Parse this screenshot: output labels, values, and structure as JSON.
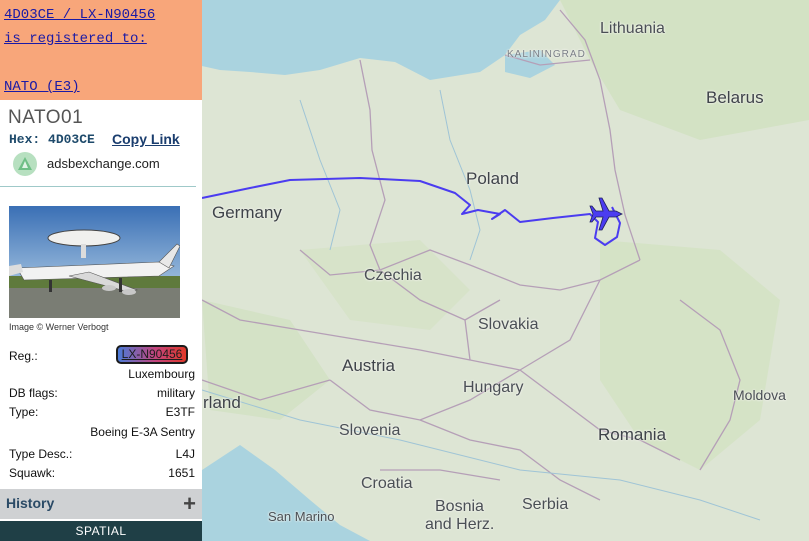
{
  "map": {
    "countries": [
      "Lithuania",
      "Belarus",
      "Poland",
      "Germany",
      "Czechia",
      "Slovakia",
      "Austria",
      "Hungary",
      "Slovenia",
      "Croatia",
      "Romania",
      "Moldova",
      "Bosnia and Herz.",
      "Serbia",
      "San Marino"
    ],
    "label_lithuania": "Lithuania",
    "label_belarus": "Belarus",
    "label_poland": "Poland",
    "label_germany": "Germany",
    "label_czechia": "Czechia",
    "label_slovakia": "Slovakia",
    "label_austria": "Austria",
    "label_hungary": "Hungary",
    "label_slovenia": "Slovenia",
    "label_croatia": "Croatia",
    "label_romania": "Romania",
    "label_moldova": "Moldova",
    "label_bosnia_1": "Bosnia",
    "label_bosnia_2": "and Herz.",
    "label_serbia": "Serbia",
    "label_san_marino": "San Marino",
    "label_kaliningrad": "KALININGRAD",
    "label_partial_land": "rland",
    "track_color": "#4b3cf0",
    "aircraft_color": "#4b3cf0"
  },
  "sidebar": {
    "banner": {
      "line1": "4D03CE / LX-N90456",
      "line2": "is registered to:",
      "line3": "NATO (E3)"
    },
    "callsign": "NATO01",
    "hex_label": "Hex:",
    "hex_value": "4D03CE",
    "copy_link": "Copy Link",
    "source": "adsbexchange.com",
    "photo_credit": "Image © Werner Verbogt",
    "fields": {
      "reg_label": "Reg.:",
      "reg_value": "LX-N90456",
      "country_value": "Luxembourg",
      "db_flags_label": "DB flags:",
      "db_flags_value": "military",
      "type_label": "Type:",
      "type_value": "E3TF",
      "type_name_value": "Boeing E-3A Sentry",
      "type_desc_label": "Type Desc.:",
      "type_desc_value": "L4J",
      "squawk_label": "Squawk:",
      "squawk_value": "1651"
    },
    "history_label": "History",
    "history_toggle": "+",
    "spatial_label": "SPATIAL"
  }
}
